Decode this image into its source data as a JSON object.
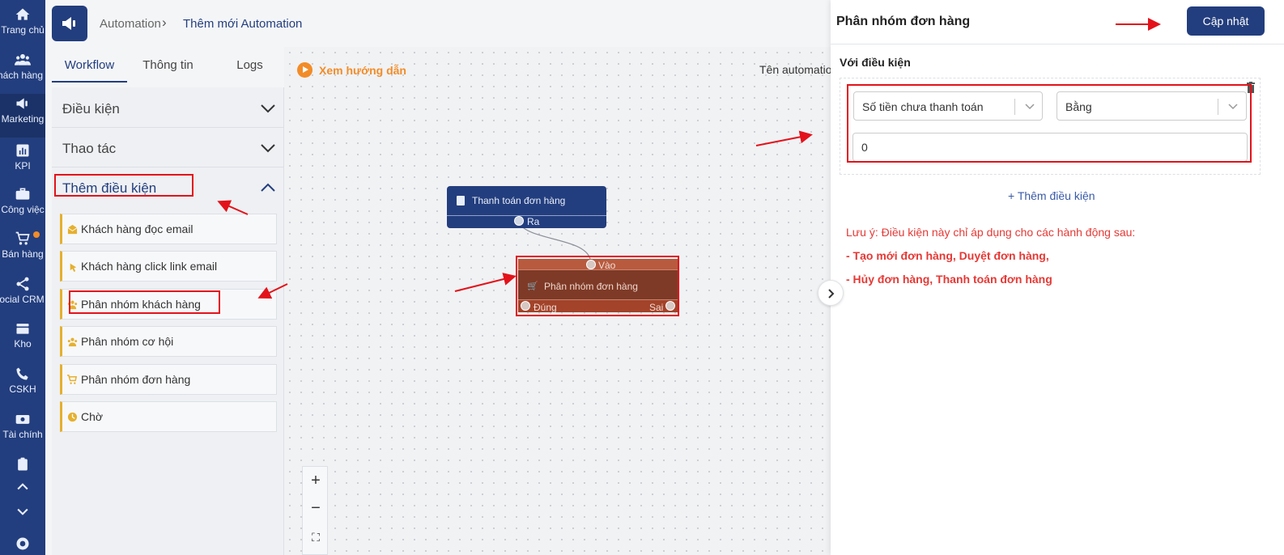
{
  "nav": {
    "items": [
      {
        "label": "Trang chủ",
        "icon": "home-icon"
      },
      {
        "label": "Khách hàng",
        "icon": "users-icon"
      },
      {
        "label": "Marketing",
        "icon": "megaphone-icon"
      },
      {
        "label": "KPI",
        "icon": "chart-icon"
      },
      {
        "label": "Công việc",
        "icon": "briefcase-icon"
      },
      {
        "label": "Bán hàng",
        "icon": "cart-icon"
      },
      {
        "label": "Social CRM",
        "icon": "share-icon"
      },
      {
        "label": "Kho",
        "icon": "warehouse-icon"
      },
      {
        "label": "CSKH",
        "icon": "phone-icon"
      },
      {
        "label": "Tài chính",
        "icon": "money-icon"
      }
    ]
  },
  "header": {
    "crumb_root": "Automation",
    "crumb_sep": "›",
    "crumb_current": "Thêm mới Automation"
  },
  "tabs": [
    {
      "label": "Workflow"
    },
    {
      "label": "Thông tin"
    },
    {
      "label": "Logs"
    }
  ],
  "panel": {
    "sections": [
      {
        "label": "Điều kiện"
      },
      {
        "label": "Thao tác"
      },
      {
        "label": "Thêm điều kiện"
      }
    ],
    "items": [
      {
        "label": "Khách hàng đọc email"
      },
      {
        "label": "Khách hàng click link email"
      },
      {
        "label": "Phân nhóm khách hàng"
      },
      {
        "label": "Phân nhóm cơ hội"
      },
      {
        "label": "Phân nhóm đơn hàng"
      },
      {
        "label": "Chờ"
      }
    ]
  },
  "canvas": {
    "guide_label": "Xem hướng dẫn",
    "automation_name_label": "Tên automatio",
    "node1": {
      "title": "Thanh toán đơn hàng",
      "out_label": "Ra"
    },
    "node2": {
      "title": "Phân nhóm đơn hàng",
      "in_label": "Vào",
      "true_label": "Đúng",
      "false_label": "Sai"
    },
    "zoom": {
      "in": "+",
      "out": "−",
      "fit": "⛶"
    }
  },
  "drawer": {
    "title": "Phân nhóm đơn hàng",
    "update_label": "Cập nhật",
    "condition_title": "Với điều kiện",
    "field_select": "Số tiền chưa thanh toán",
    "operator_select": "Bằng",
    "value_input": "0",
    "add_condition": "+ Thêm điều kiện",
    "note_line1": "Lưu ý: Điều kiện này chỉ áp dụng cho các hành động sau:",
    "note_line2": "- Tạo mới đơn hàng, Duyệt đơn hàng,",
    "note_line3": "- Hủy đơn hàng, Thanh toán đơn hàng"
  },
  "colors": {
    "primary": "#233e7e",
    "accent": "#f28c28",
    "node_condition": "#a2432a",
    "annotation": "#e3121a",
    "note": "#e53935"
  }
}
